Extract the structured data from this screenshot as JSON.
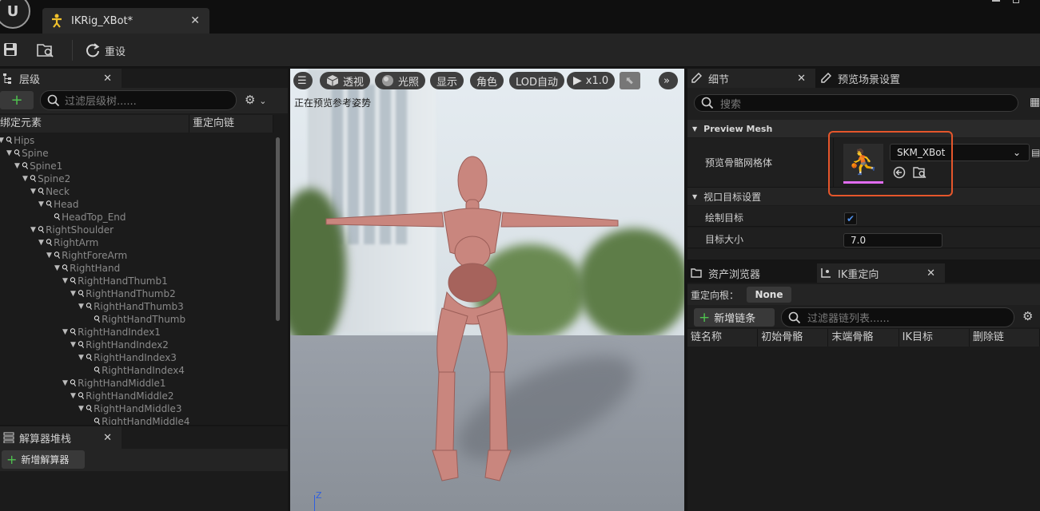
{
  "title_bar": {
    "logo": "U",
    "doc_tab_label": "IKRig_XBot*",
    "doc_tab_icon": "ik-rig-icon",
    "close_glyph": "✕"
  },
  "toolbar": {
    "reset_label": "重设"
  },
  "hierarchy": {
    "tab_label": "层级",
    "search_placeholder": "过滤层级树......",
    "col_bone": "绑定元素",
    "col_chain": "重定向链",
    "bones": [
      {
        "name": "Hips",
        "depth": 0,
        "exp": true
      },
      {
        "name": "Spine",
        "depth": 1,
        "exp": true
      },
      {
        "name": "Spine1",
        "depth": 2,
        "exp": true
      },
      {
        "name": "Spine2",
        "depth": 3,
        "exp": true
      },
      {
        "name": "Neck",
        "depth": 4,
        "exp": true
      },
      {
        "name": "Head",
        "depth": 5,
        "exp": true
      },
      {
        "name": "HeadTop_End",
        "depth": 6,
        "exp": false
      },
      {
        "name": "RightShoulder",
        "depth": 4,
        "exp": true
      },
      {
        "name": "RightArm",
        "depth": 5,
        "exp": true
      },
      {
        "name": "RightForeArm",
        "depth": 6,
        "exp": true
      },
      {
        "name": "RightHand",
        "depth": 7,
        "exp": true
      },
      {
        "name": "RightHandThumb1",
        "depth": 8,
        "exp": true
      },
      {
        "name": "RightHandThumb2",
        "depth": 9,
        "exp": true
      },
      {
        "name": "RightHandThumb3",
        "depth": 10,
        "exp": true
      },
      {
        "name": "RightHandThumb",
        "depth": 11,
        "exp": false
      },
      {
        "name": "RightHandIndex1",
        "depth": 8,
        "exp": true
      },
      {
        "name": "RightHandIndex2",
        "depth": 9,
        "exp": true
      },
      {
        "name": "RightHandIndex3",
        "depth": 10,
        "exp": true
      },
      {
        "name": "RightHandIndex4",
        "depth": 11,
        "exp": false
      },
      {
        "name": "RightHandMiddle1",
        "depth": 8,
        "exp": true
      },
      {
        "name": "RightHandMiddle2",
        "depth": 9,
        "exp": true
      },
      {
        "name": "RightHandMiddle3",
        "depth": 10,
        "exp": true
      },
      {
        "name": "RightHandMiddle4",
        "depth": 11,
        "exp": false
      }
    ]
  },
  "solver_stack": {
    "tab_label": "解算器堆栈",
    "add_label": "新增解算器"
  },
  "viewport": {
    "btn_menu": "☰",
    "btn_perspective": "透视",
    "btn_lit": "光照",
    "btn_show": "显示",
    "btn_character": "角色",
    "btn_lod": "LOD自动",
    "btn_speed": "x1.0",
    "btn_more": "»",
    "status": "正在预览参考姿势",
    "axis_label": "Z"
  },
  "details": {
    "tab_details": "细节",
    "tab_preview_scene": "预览场景设置",
    "search_placeholder": "搜索",
    "section_preview_mesh": "Preview Mesh",
    "preview_mesh_label": "预览骨骼网格体",
    "preview_mesh_value": "SKM_XBot",
    "section_viewport_goals": "视口目标设置",
    "draw_goals_label": "绘制目标",
    "draw_goals_checked": true,
    "goal_size_label": "目标大小",
    "goal_size_value": "7.0",
    "highlight_color": "#e5562b"
  },
  "retarget": {
    "tab_asset_browser": "资产浏览器",
    "tab_ik_retarget": "IK重定向",
    "root_label": "重定向根：",
    "root_value": "None",
    "add_chain_label": "新增链条",
    "search_placeholder": "过滤器链列表......",
    "columns": [
      "链名称",
      "初始骨骼",
      "末端骨骼",
      "IK目标",
      "删除链"
    ]
  }
}
